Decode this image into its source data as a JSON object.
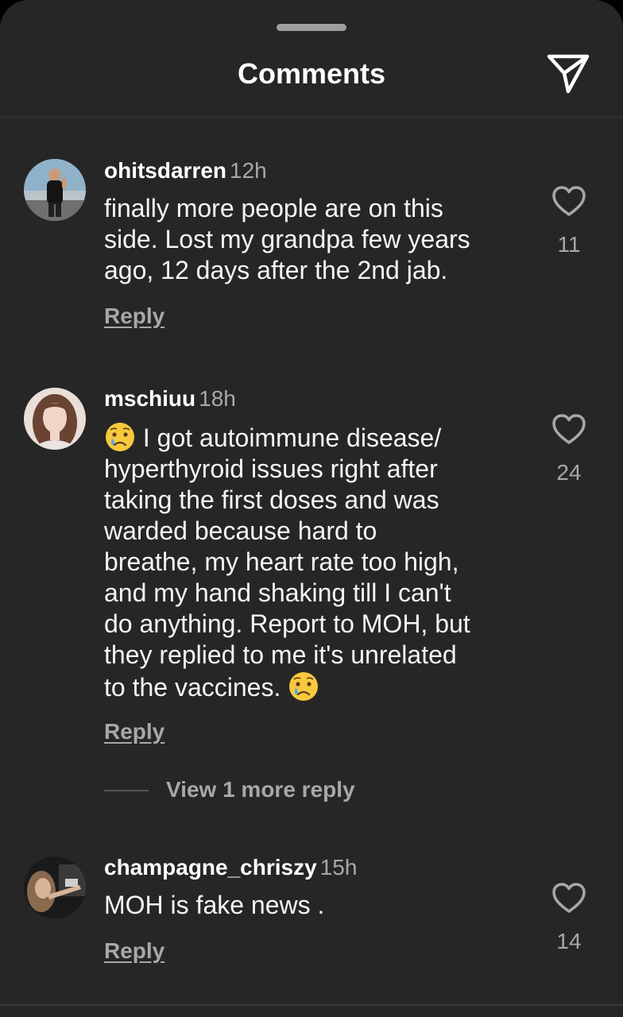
{
  "header": {
    "title": "Comments",
    "share_icon": "paper-plane-icon"
  },
  "comments": [
    {
      "username": "ohitsdarren",
      "time": "12h",
      "lines": [
        "finally more people are on this",
        "side. Lost my grandpa few years",
        "ago, 12 days after the 2nd jab."
      ],
      "reply_label": "Reply",
      "like_count": "11"
    },
    {
      "username": "mschiuu",
      "time": "18h",
      "lines": [
        "I got autoimmune disease/",
        "hyperthyroid issues right after",
        "taking the first doses and was",
        "warded because hard to",
        "breathe, my heart rate too high,",
        "and my hand shaking till I can't",
        "do anything. Report to MOH, but",
        "they replied to me it's unrelated",
        "to the vaccines."
      ],
      "emoji": "crying-face-emoji",
      "reply_label": "Reply",
      "like_count": "24",
      "more_replies_label": "View 1 more reply"
    },
    {
      "username": "champagne_chriszy",
      "time": "15h",
      "lines": [
        "MOH is fake news ."
      ],
      "reply_label": "Reply",
      "like_count": "14"
    }
  ],
  "colors": {
    "sheet_background": "#262626",
    "primary_text": "#f5f5f5",
    "secondary_text": "#a8a8a8"
  }
}
